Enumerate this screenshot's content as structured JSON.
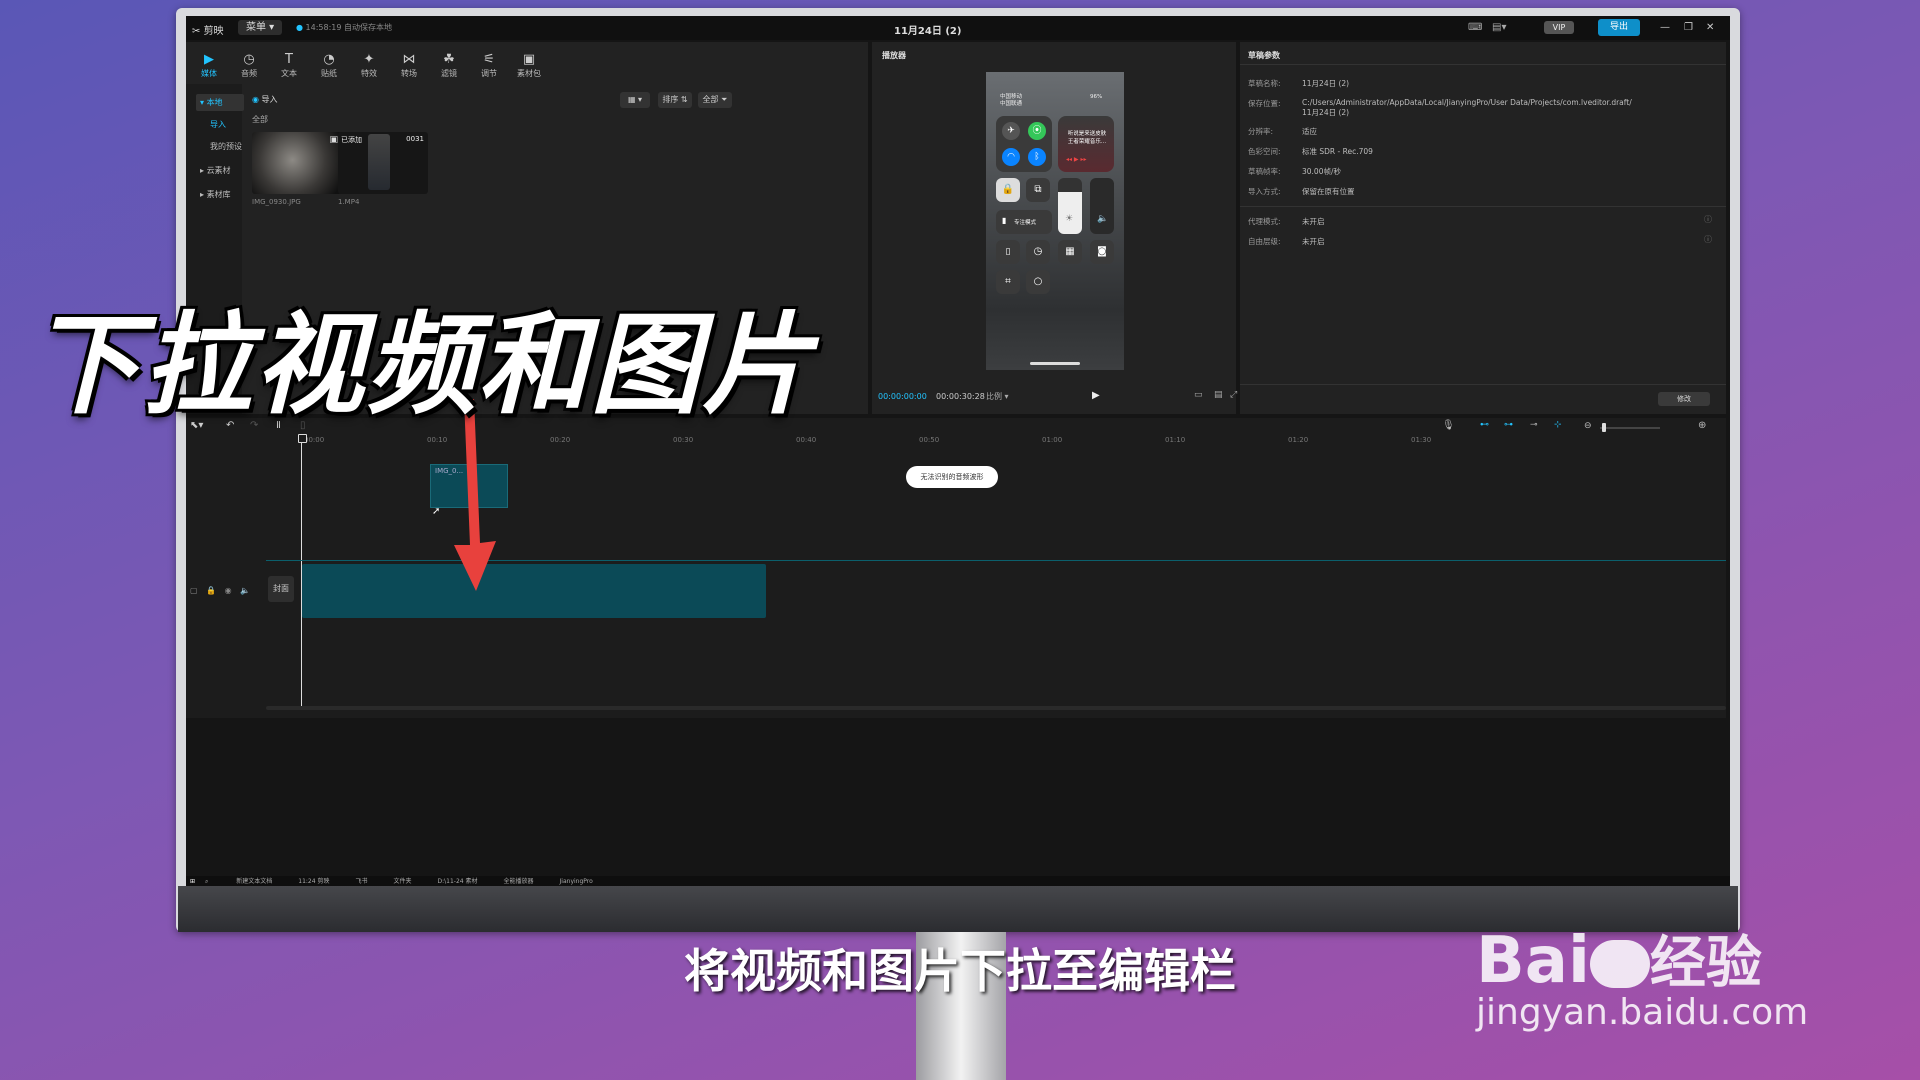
{
  "app": {
    "name": "剪映",
    "menu_label": "菜单",
    "autosave_text": "14:58:19 自动保存本地",
    "project_title": "11月24日 (2)",
    "vip_label": "VIP",
    "export_label": "导出"
  },
  "toolbar": {
    "items": [
      {
        "label": "媒体",
        "icon": "media-icon"
      },
      {
        "label": "音频",
        "icon": "audio-icon"
      },
      {
        "label": "文本",
        "icon": "text-icon"
      },
      {
        "label": "贴纸",
        "icon": "sticker-icon"
      },
      {
        "label": "特效",
        "icon": "effects-icon"
      },
      {
        "label": "转场",
        "icon": "transition-icon"
      },
      {
        "label": "滤镜",
        "icon": "filter-icon"
      },
      {
        "label": "调节",
        "icon": "adjust-icon"
      },
      {
        "label": "素材包",
        "icon": "material-pack-icon"
      }
    ]
  },
  "media_sidebar": {
    "items": [
      "本地",
      "导入",
      "我的预设",
      "云素材",
      "素材库"
    ]
  },
  "media_panel": {
    "import_label": "导入",
    "filter_all": "全部",
    "sort_label": "排序",
    "all_filter_label": "全部",
    "media": [
      {
        "name": "IMG_0930.JPG",
        "badge": ""
      },
      {
        "name": "1.MP4",
        "badge": "已添加",
        "duration": "0031"
      }
    ]
  },
  "player": {
    "title": "播放器",
    "current_time": "00:00:00:00",
    "total_time": "00:00:30:28",
    "ratio_label": "比例",
    "phone": {
      "carrier1": "中国移动",
      "carrier2": "中国联通",
      "battery": "96%",
      "music_line1": "听说是来送皮肤",
      "music_line2": "王者荣耀音乐...",
      "focus_label": "专注模式"
    }
  },
  "draft_params": {
    "title": "草稿参数",
    "rows": [
      {
        "label": "草稿名称:",
        "value": "11月24日 (2)"
      },
      {
        "label": "保存位置:",
        "value": "C:/Users/Administrator/AppData/Local/JianyingPro/User Data/Projects/com.lveditor.draft/11月24日 (2)"
      },
      {
        "label": "分辨率:",
        "value": "适应"
      },
      {
        "label": "色彩空间:",
        "value": "标准 SDR - Rec.709"
      },
      {
        "label": "草稿帧率:",
        "value": "30.00帧/秒"
      },
      {
        "label": "导入方式:",
        "value": "保留在原有位置"
      },
      {
        "label": "代理模式:",
        "value": "未开启"
      },
      {
        "label": "自由层级:",
        "value": "未开启"
      }
    ],
    "edit_label": "修改"
  },
  "timeline": {
    "ruler": [
      "00:00",
      "00:10",
      "00:20",
      "00:30",
      "00:40",
      "00:50",
      "01:00",
      "01:10",
      "01:20",
      "01:30"
    ],
    "dragging_clip_label": "IMG_0...",
    "toast": "无法识别的音频波形",
    "cover_label": "封面"
  },
  "taskbar": {
    "items": [
      "新建文本文档",
      "11:24 剪映",
      "飞书",
      "文件夹",
      "D:\\11-24 素材",
      "全能播放器",
      "JianyingPro"
    ]
  },
  "overlay": {
    "big_title": "下拉视频和图片",
    "subtitle": "将视频和图片下拉至编辑栏",
    "watermark_brand_suffix": "经验",
    "watermark_url": "jingyan.baidu.com"
  },
  "colors": {
    "accent": "#22c4ff",
    "export": "#0e8fc9",
    "clip": "#0b4a57",
    "arrow": "#e8413d"
  }
}
